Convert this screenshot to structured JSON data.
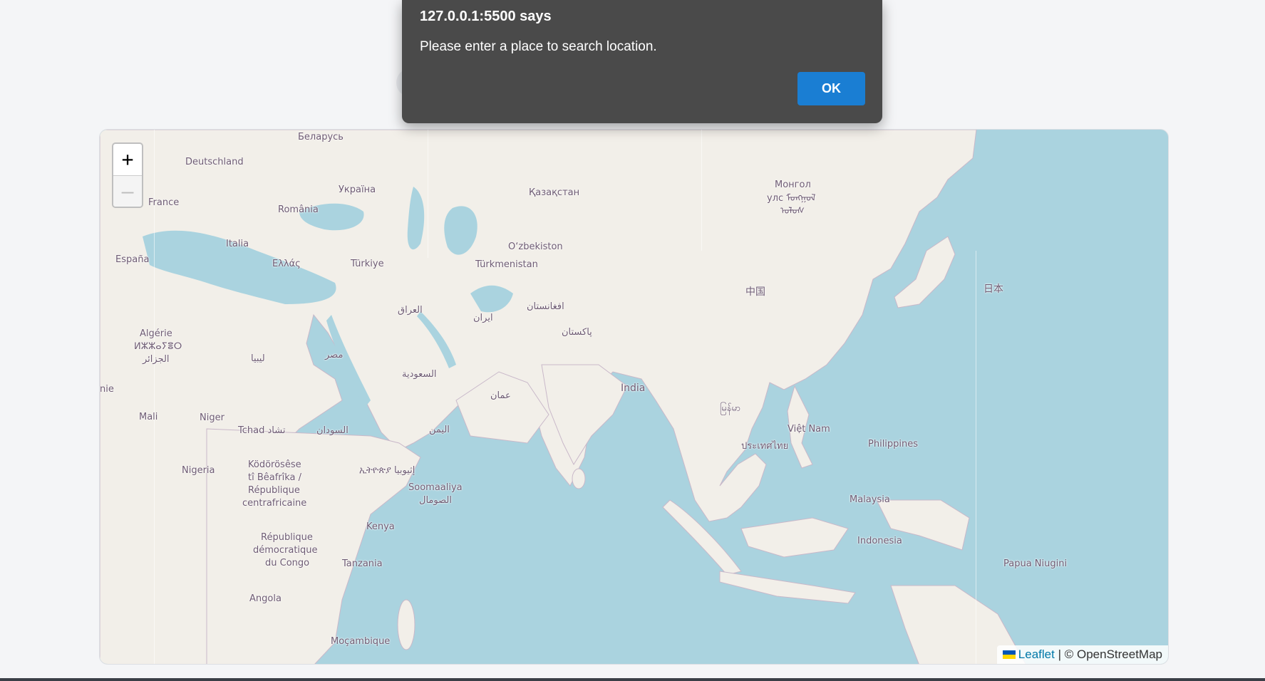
{
  "dialog": {
    "title": "127.0.0.1:5500 says",
    "message": "Please enter a place to search location.",
    "ok_label": "OK"
  },
  "map": {
    "zoom_in_label": "+",
    "zoom_out_label": "—",
    "attribution": {
      "leaflet_label": "Leaflet",
      "separator": "|",
      "osm_label": "© OpenStreetMap"
    },
    "labels": {
      "belarus": "Беларусь",
      "deutschland": "Deutschland",
      "ukraina": "Україна",
      "france": "France",
      "romania": "România",
      "kazakhstan": "Қазақстан",
      "mongolia_1": "Монгол",
      "mongolia_2": "улс ᠮᠣᠩᠭᠣᠯ",
      "mongolia_3": "ᠤᠯᠤᠰ",
      "italia": "Italia",
      "espana": "España",
      "ellada": "Ελλάς",
      "turkiye": "Türkiye",
      "uzbekistan": "O‘zbekiston",
      "turkmenistan": "Türkmenistan",
      "china": "中国",
      "japan": "日本",
      "iraq": "العراق",
      "iran": "ایران",
      "afghanistan": "افغانستان",
      "pakistan": "پاکستان",
      "algeria_1": "Algérie",
      "algeria_2": "ⵍⵣⵣⴰⵢⴻⵔ",
      "algeria_3": "الجزائر",
      "libya": "ليبيا",
      "egypt": "مصر",
      "saudi": "السعودية",
      "oman": "عمان",
      "india": "India",
      "myanmar": "မြန်မာ",
      "vietnam": "Việt Nam",
      "thailand": "ประเทศไทย",
      "philippines": "Philippines",
      "mauritanie": "nie",
      "mali": "Mali",
      "niger": "Niger",
      "tchad": "Tchad تشاد",
      "sudan": "السودان",
      "yemen": "اليمن",
      "nigeria": "Nigeria",
      "car_1": "Ködörösêse",
      "car_2": "tî Bêafrîka /",
      "car_3": "République",
      "car_4": "centrafricaine",
      "ethiopia": "ኢትዮጵያ إثيوبيا",
      "somalia_1": "Soomaaliya",
      "somalia_2": "الصومال",
      "malaysia": "Malaysia",
      "kenya": "Kenya",
      "indonesia": "Indonesia",
      "drc_1": "République",
      "drc_2": "démocratique",
      "drc_3": "du Congo",
      "tanzania": "Tanzania",
      "png": "Papua Niugini",
      "angola": "Angola",
      "mozambique": "Moçambique"
    }
  },
  "colors": {
    "water": "#aad3df",
    "land": "#f2efe9",
    "dialog_bg": "#4a4a4a",
    "ok_button": "#1a7ed3",
    "page_bg": "#f4f5f7"
  }
}
